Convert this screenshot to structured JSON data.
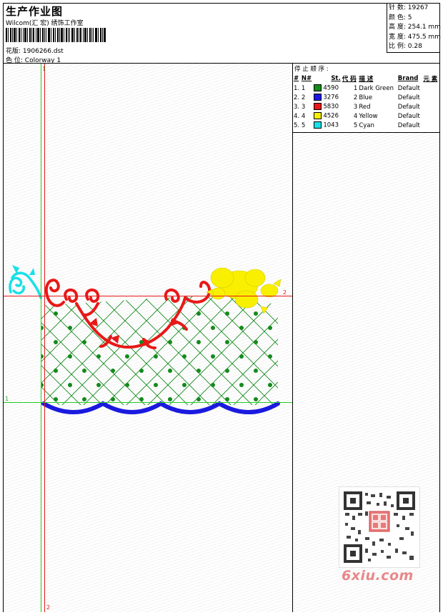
{
  "header": {
    "title": "生产作业图",
    "company": "Wilcom(汇 宏) 绣饰工作室",
    "pattern_label": "花版:",
    "pattern_value": "1906266.dst",
    "colorway_label": "色 位:",
    "colorway_value": "Colorway 1"
  },
  "stats": [
    {
      "label": "针 数:",
      "value": "19267"
    },
    {
      "label": "颜 色:",
      "value": "5"
    },
    {
      "label": "高 度:",
      "value": "254.1 mm"
    },
    {
      "label": "宽 度:",
      "value": "475.5 mm"
    },
    {
      "label": "比 例:",
      "value": "0.28"
    }
  ],
  "stop_sequence": {
    "title": "停 止 顺 序 :",
    "columns": [
      "#",
      "N#",
      "St.",
      "代 码",
      "描 述",
      "Brand",
      "元 素"
    ],
    "rows": [
      {
        "idx": "1.",
        "n": "1",
        "color": "#148a1c",
        "st": "4590",
        "code": "1",
        "desc": "Dark Green",
        "brand": "Default"
      },
      {
        "idx": "2.",
        "n": "2",
        "color": "#1a1adf",
        "st": "3276",
        "code": "2",
        "desc": "Blue",
        "brand": "Default"
      },
      {
        "idx": "3.",
        "n": "3",
        "color": "#e81818",
        "st": "5830",
        "code": "3",
        "desc": "Red",
        "brand": "Default"
      },
      {
        "idx": "4.",
        "n": "4",
        "color": "#f8f000",
        "st": "4526",
        "code": "4",
        "desc": "Yellow",
        "brand": "Default"
      },
      {
        "idx": "5.",
        "n": "5",
        "color": "#18e0e8",
        "st": "1043",
        "code": "5",
        "desc": "Cyan",
        "brand": "Default"
      }
    ]
  },
  "guides": {
    "horizontal_1": "1",
    "horizontal_2": "2",
    "vertical_1": "1",
    "vertical_2": "2"
  },
  "watermark": "6xiu.com",
  "colors": {
    "dark_green": "#148a1c",
    "blue": "#1a1adf",
    "red": "#e81818",
    "yellow": "#f8f000",
    "cyan": "#18e0e8"
  }
}
